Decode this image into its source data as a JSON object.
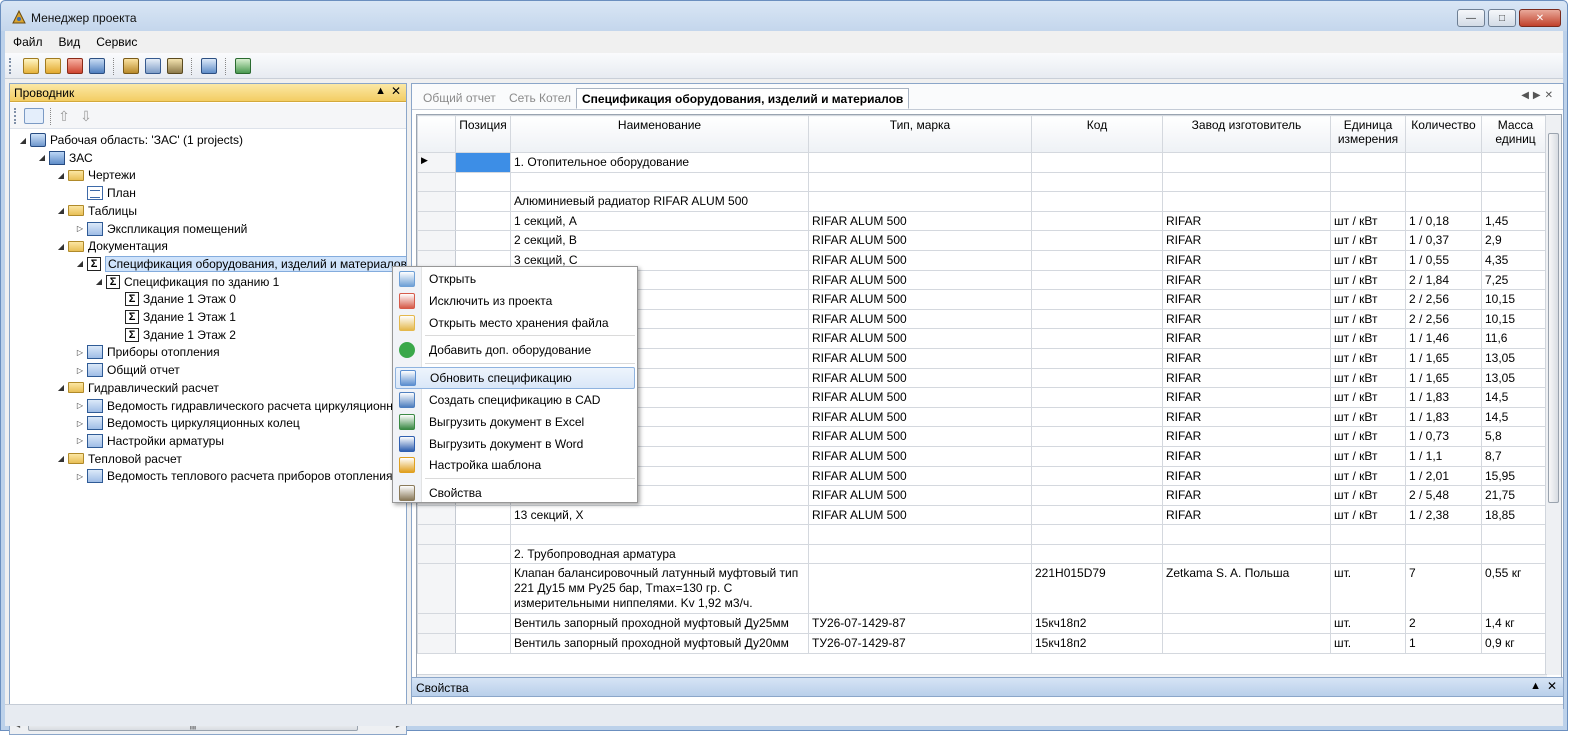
{
  "window": {
    "title": "Менеджер проекта"
  },
  "menu": [
    "Файл",
    "Вид",
    "Сервис"
  ],
  "explorer": {
    "title": "Проводник",
    "tree": [
      {
        "label": "Рабочая область: 'ЗАС' (1 projects)",
        "icon": "workspace-icon",
        "depth": 0,
        "arrow": "expanded"
      },
      {
        "label": "ЗАС",
        "icon": "project-icon",
        "depth": 1,
        "arrow": "expanded"
      },
      {
        "label": "Чертежи",
        "icon": "folder-icon",
        "depth": 2,
        "arrow": "expanded"
      },
      {
        "label": "План",
        "icon": "drawing-icon",
        "depth": 3,
        "arrow": ""
      },
      {
        "label": "Таблицы",
        "icon": "folder-icon",
        "depth": 2,
        "arrow": "expanded"
      },
      {
        "label": "Экспликация помещений",
        "icon": "table-icon",
        "depth": 3,
        "arrow": "collapsed"
      },
      {
        "label": "Документация",
        "icon": "folder-icon",
        "depth": 2,
        "arrow": "expanded"
      },
      {
        "label": "Спецификация оборудования, изделий и материалов",
        "icon": "sigma-icon",
        "depth": 3,
        "arrow": "expanded",
        "selected": true
      },
      {
        "label": "Спецификация по зданию 1",
        "icon": "sigma-icon",
        "depth": 4,
        "arrow": "expanded"
      },
      {
        "label": "Здание 1 Этаж 0",
        "icon": "sigma-icon",
        "depth": 5,
        "arrow": ""
      },
      {
        "label": "Здание 1 Этаж 1",
        "icon": "sigma-icon",
        "depth": 5,
        "arrow": ""
      },
      {
        "label": "Здание 1 Этаж 2",
        "icon": "sigma-icon",
        "depth": 5,
        "arrow": ""
      },
      {
        "label": "Приборы отопления",
        "icon": "table-icon",
        "depth": 3,
        "arrow": "collapsed"
      },
      {
        "label": "Общий отчет",
        "icon": "table-icon",
        "depth": 3,
        "arrow": "collapsed"
      },
      {
        "label": "Гидравлический расчет",
        "icon": "folder-icon",
        "depth": 2,
        "arrow": "expanded"
      },
      {
        "label": "Ведомость гидравлического расчета циркуляционн",
        "icon": "table-icon",
        "depth": 3,
        "arrow": "collapsed"
      },
      {
        "label": "Ведомость циркуляционных колец",
        "icon": "table-icon",
        "depth": 3,
        "arrow": "collapsed"
      },
      {
        "label": "Настройки арматуры",
        "icon": "table-icon",
        "depth": 3,
        "arrow": "collapsed"
      },
      {
        "label": "Тепловой расчет",
        "icon": "folder-icon",
        "depth": 2,
        "arrow": "expanded"
      },
      {
        "label": "Ведомость теплового расчета приборов отопления",
        "icon": "table-icon",
        "depth": 3,
        "arrow": "collapsed"
      }
    ]
  },
  "tabs": [
    {
      "label": "Общий отчет",
      "active": false
    },
    {
      "label": "Сеть Котел",
      "active": false
    },
    {
      "label": "Спецификация оборудования, изделий и материалов",
      "active": true
    }
  ],
  "grid": {
    "columns": [
      "Позиция",
      "Наименование",
      "Тип, марка",
      "Код",
      "Завод изготовитель",
      "Единица измерения",
      "Количество",
      "Масса единиц"
    ],
    "rows": [
      {
        "cells": [
          "",
          "1. Отопительное оборудование",
          "",
          "",
          "",
          "",
          "",
          ""
        ],
        "current": true
      },
      {
        "cells": [
          "",
          "",
          "",
          "",
          "",
          "",
          "",
          ""
        ]
      },
      {
        "cells": [
          "",
          "Алюминиевый радиатор RIFAR ALUM 500",
          "",
          "",
          "",
          "",
          "",
          ""
        ]
      },
      {
        "cells": [
          "",
          "1 секций, A",
          "RIFAR ALUM 500",
          "",
          "RIFAR",
          "шт / кВт",
          "1 / 0,18",
          "1,45"
        ]
      },
      {
        "cells": [
          "",
          "2 секций, B",
          "RIFAR ALUM 500",
          "",
          "RIFAR",
          "шт / кВт",
          "1 / 0,37",
          "2,9"
        ]
      },
      {
        "cells": [
          "",
          "3 секций, C",
          "RIFAR ALUM 500",
          "",
          "RIFAR",
          "шт / кВт",
          "1 / 0,55",
          "4,35"
        ]
      },
      {
        "cells": [
          "",
          "",
          "RIFAR ALUM 500",
          "",
          "RIFAR",
          "шт / кВт",
          "2 / 1,84",
          "7,25"
        ]
      },
      {
        "cells": [
          "",
          "",
          "RIFAR ALUM 500",
          "",
          "RIFAR",
          "шт / кВт",
          "2 / 2,56",
          "10,15"
        ]
      },
      {
        "cells": [
          "",
          "",
          "RIFAR ALUM 500",
          "",
          "RIFAR",
          "шт / кВт",
          "2 / 2,56",
          "10,15"
        ]
      },
      {
        "cells": [
          "",
          "",
          "RIFAR ALUM 500",
          "",
          "RIFAR",
          "шт / кВт",
          "1 / 1,46",
          "11,6"
        ]
      },
      {
        "cells": [
          "",
          "",
          "RIFAR ALUM 500",
          "",
          "RIFAR",
          "шт / кВт",
          "1 / 1,65",
          "13,05"
        ]
      },
      {
        "cells": [
          "",
          "",
          "RIFAR ALUM 500",
          "",
          "RIFAR",
          "шт / кВт",
          "1 / 1,65",
          "13,05"
        ]
      },
      {
        "cells": [
          "",
          "",
          "RIFAR ALUM 500",
          "",
          "RIFAR",
          "шт / кВт",
          "1 / 1,83",
          "14,5"
        ]
      },
      {
        "cells": [
          "",
          "",
          "RIFAR ALUM 500",
          "",
          "RIFAR",
          "шт / кВт",
          "1 / 1,83",
          "14,5"
        ]
      },
      {
        "cells": [
          "",
          "",
          "RIFAR ALUM 500",
          "",
          "RIFAR",
          "шт / кВт",
          "1 / 0,73",
          "5,8"
        ]
      },
      {
        "cells": [
          "",
          "",
          "RIFAR ALUM 500",
          "",
          "RIFAR",
          "шт / кВт",
          "1 / 1,1",
          "8,7"
        ]
      },
      {
        "cells": [
          "",
          "",
          "RIFAR ALUM 500",
          "",
          "RIFAR",
          "шт / кВт",
          "1 / 2,01",
          "15,95"
        ]
      },
      {
        "cells": [
          "",
          "",
          "RIFAR ALUM 500",
          "",
          "RIFAR",
          "шт / кВт",
          "2 / 5,48",
          "21,75"
        ]
      },
      {
        "cells": [
          "",
          "13 секций, X",
          "RIFAR ALUM 500",
          "",
          "RIFAR",
          "шт / кВт",
          "1 / 2,38",
          "18,85"
        ]
      },
      {
        "cells": [
          "",
          "",
          "",
          "",
          "",
          "",
          "",
          ""
        ]
      },
      {
        "cells": [
          "",
          "2. Трубопроводная арматура",
          "",
          "",
          "",
          "",
          "",
          ""
        ]
      },
      {
        "cells": [
          "",
          "Клапан балансировочный латунный муфтовый тип 221 Ду15 мм Ру25 бар, Tmax=130 гр. С измерительными ниппелями. Kv 1,92 м3/ч.",
          "",
          "221H015D79",
          "Zetkama S. A. Польша",
          "шт.",
          "7",
          "0,55 кг"
        ],
        "tall": true
      },
      {
        "cells": [
          "",
          "Вентиль запорный проходной муфтовый Ду25мм",
          "ТУ26-07-1429-87",
          "15кч18п2",
          "",
          "шт.",
          "2",
          "1,4 кг"
        ]
      },
      {
        "cells": [
          "",
          "Вентиль запорный проходной муфтовый Ду20мм",
          "ТУ26-07-1429-87",
          "15кч18п2",
          "",
          "шт.",
          "1",
          "0,9 кг"
        ]
      }
    ]
  },
  "context_menu": {
    "items": [
      {
        "label": "Открыть",
        "icon": "open-icon",
        "color": "#6fa0d6"
      },
      {
        "label": "Исключить из проекта",
        "icon": "exclude-icon",
        "color": "#d65b4a"
      },
      {
        "label": "Открыть место хранения файла",
        "icon": "folder-open-icon",
        "color": "#e4b84c"
      },
      {
        "sep": true
      },
      {
        "label": "Добавить доп. оборудование",
        "icon": "add-icon",
        "color": "#3aa84a"
      },
      {
        "sep": true
      },
      {
        "label": "Обновить спецификацию",
        "icon": "refresh-icon",
        "color": "#5c8fd0",
        "highlight": true
      },
      {
        "label": "Создать спецификацию в CAD",
        "icon": "cad-icon",
        "color": "#4f7fbf"
      },
      {
        "label": "Выгрузить документ в Excel",
        "icon": "excel-icon",
        "color": "#3b8a45"
      },
      {
        "label": "Выгрузить документ в Word",
        "icon": "word-icon",
        "color": "#2f5fb0"
      },
      {
        "label": "Настройка шаблона",
        "icon": "template-edit-icon",
        "color": "#e0a020"
      },
      {
        "sep": true
      },
      {
        "label": "Свойства",
        "icon": "properties-icon",
        "color": "#8a7a5a"
      }
    ]
  },
  "properties_panel": {
    "title": "Свойства"
  },
  "colors": {
    "accent": "#3d8ee6",
    "panel_header": "#f3cd63",
    "window_frame": "#bcd1ea"
  }
}
